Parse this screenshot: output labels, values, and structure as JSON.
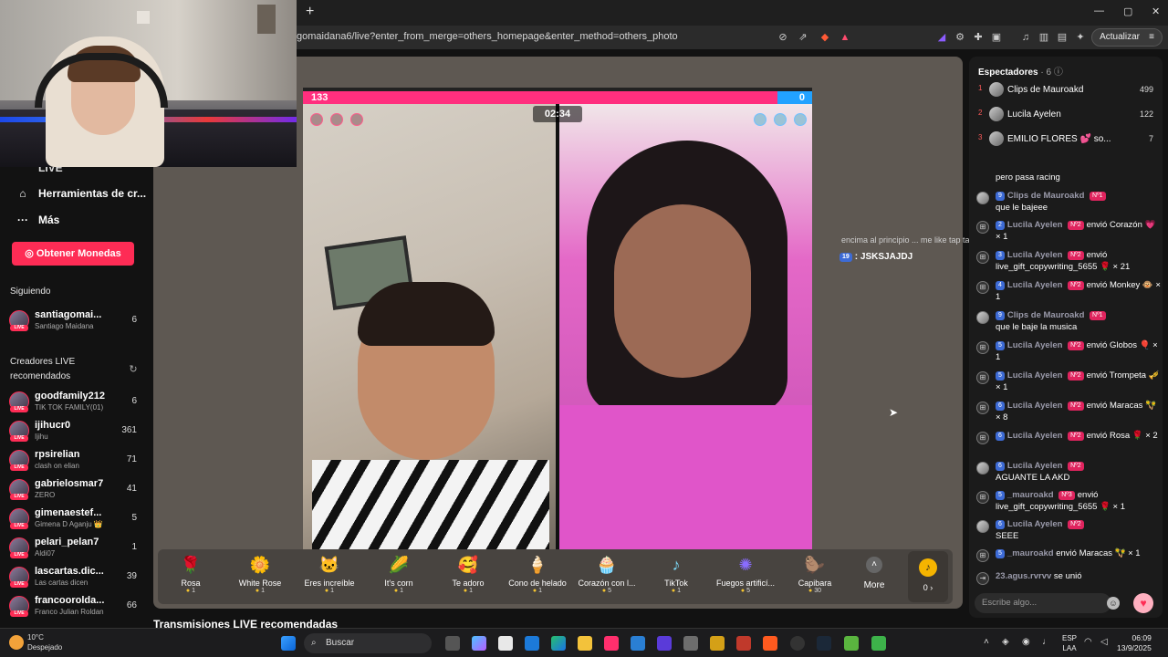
{
  "browser": {
    "new_tab": "+",
    "url": "gomaidana6/live?enter_from_merge=others_homepage&enter_method=others_photo",
    "update_button": "Actualizar",
    "window_controls": [
      "—",
      "▢",
      "✕"
    ]
  },
  "sidebar": {
    "partial_item": "LIVE",
    "nav": [
      {
        "icon": "tools-icon",
        "label": "Herramientas de cr..."
      },
      {
        "icon": "more-dots-icon",
        "label": "Más"
      }
    ],
    "coins_button": "Obtener Monedas",
    "following_title": "Siguiendo",
    "following": [
      {
        "name": "santiagomai...",
        "sub": "Santiago Maidana",
        "count": "6"
      }
    ],
    "recommended_title": "Creadores LIVE recomendados",
    "recommended": [
      {
        "name": "goodfamily212",
        "sub": "TIK TOK FAMILY(01)",
        "count": "6"
      },
      {
        "name": "ijihucr0",
        "sub": "Ijihu",
        "count": "361"
      },
      {
        "name": "rpsirelian",
        "sub": "clash on elian",
        "count": "71"
      },
      {
        "name": "gabrielosmar7",
        "sub": "ZERO",
        "count": "41"
      },
      {
        "name": "gimenaestef...",
        "sub": "Gimena D Aganju 👑",
        "count": "5"
      },
      {
        "name": "pelari_pelan7",
        "sub": "Aldi07",
        "count": "1"
      },
      {
        "name": "lascartas.dic...",
        "sub": "Las cartas dicen",
        "count": "39"
      },
      {
        "name": "francoorolda...",
        "sub": "Franco Julian Roldan",
        "count": "66"
      }
    ],
    "live_badge": "LIVE"
  },
  "battle": {
    "score_left": "133",
    "score_right": "0",
    "timer": "02:34",
    "chat_line1": "encima al principio ... me like tap tap a la panta",
    "chat_line2_level": "19",
    "chat_line2_text": ": JSKSJAJDJ"
  },
  "gifts": [
    {
      "name": "Rosa",
      "price": "1",
      "icon": "🌹",
      "color": "#c0204a"
    },
    {
      "name": "White Rose",
      "price": "1",
      "icon": "🌼",
      "color": "#e8e8d8"
    },
    {
      "name": "Eres increíble",
      "price": "1",
      "icon": "🐱",
      "color": "#d2a46a"
    },
    {
      "name": "It's corn",
      "price": "1",
      "icon": "🌽",
      "color": "#f2c230"
    },
    {
      "name": "Te adoro",
      "price": "1",
      "icon": "🥰",
      "color": "#ff5a4a"
    },
    {
      "name": "Cono de helado",
      "price": "1",
      "icon": "🍦",
      "color": "#f5b8d0"
    },
    {
      "name": "Corazón con l...",
      "price": "5",
      "icon": "🧁",
      "color": "#f6a38c"
    },
    {
      "name": "TikTok",
      "price": "1",
      "icon": "♪",
      "color": "#7ad3f0"
    },
    {
      "name": "Fuegos artificí...",
      "price": "5",
      "icon": "✺",
      "color": "#8a6cff"
    },
    {
      "name": "Capibara",
      "price": "30",
      "icon": "🦫",
      "color": "#a57a4c"
    }
  ],
  "more_label": "More",
  "coins_balance": "0 ›",
  "recommended_section": "Transmisiones LIVE recomendadas",
  "viewers": {
    "title": "Espectadores",
    "count": "· 6",
    "list": [
      {
        "rank": "1",
        "name": "Clips de Mauroakd",
        "score": "499"
      },
      {
        "rank": "2",
        "name": "Lucila Ayelen",
        "score": "122"
      },
      {
        "rank": "3",
        "name": "EMILIO FLORES 💕 so...",
        "score": "7"
      }
    ]
  },
  "chat": [
    {
      "type": "text",
      "level": "",
      "user": "",
      "rank": "",
      "text": "pero pasa racing"
    },
    {
      "type": "avatar",
      "level": "9",
      "user": "Clips de Mauroakd",
      "rank": "Nº1",
      "text": "que le bajeee"
    },
    {
      "type": "gift",
      "level": "2",
      "user": "Lucila Ayelen",
      "rank": "Nº2",
      "text": "envió Corazón 💗 × 1"
    },
    {
      "type": "gift",
      "level": "3",
      "user": "Lucila Ayelen",
      "rank": "Nº2",
      "text": "envió live_gift_copywriting_5655 🌹 × 21"
    },
    {
      "type": "gift",
      "level": "4",
      "user": "Lucila Ayelen",
      "rank": "Nº2",
      "text": "envió Monkey 🐵 × 1"
    },
    {
      "type": "avatar",
      "level": "9",
      "user": "Clips de Mauroakd",
      "rank": "Nº1",
      "text": "que le baje la musica"
    },
    {
      "type": "gift",
      "level": "5",
      "user": "Lucila Ayelen",
      "rank": "Nº2",
      "text": "envió Globos 🎈 × 1"
    },
    {
      "type": "gift",
      "level": "5",
      "user": "Lucila Ayelen",
      "rank": "Nº2",
      "text": "envió Trompeta 🎺 × 1"
    },
    {
      "type": "gift",
      "level": "6",
      "user": "Lucila Ayelen",
      "rank": "Nº2",
      "text": "envió Maracas 🪇 × 8"
    },
    {
      "type": "gift",
      "level": "6",
      "user": "Lucila Ayelen",
      "rank": "Nº2",
      "text": "envió Rosa 🌹 × 2"
    },
    {
      "type": "avatar",
      "level": "6",
      "user": "Lucila Ayelen",
      "rank": "Nº2",
      "text": "AGUANTE LA AKD"
    },
    {
      "type": "gift",
      "level": "5",
      "user": "_mauroakd",
      "rank": "Nº3",
      "text": "envió live_gift_copywriting_5655 🌹 × 1"
    },
    {
      "type": "avatar",
      "level": "6",
      "user": "Lucila Ayelen",
      "rank": "Nº2",
      "text": "SEEE"
    },
    {
      "type": "gift",
      "level": "5",
      "user": "_mauroakd",
      "rank": "",
      "text": "envió Maracas 🪇 × 1"
    },
    {
      "type": "join",
      "level": "",
      "user": "23.agus.rvrvv",
      "rank": "",
      "text": "se unió"
    }
  ],
  "comment_placeholder": "Escribe algo...",
  "taskbar": {
    "temp": "10°C",
    "weather": "Despejado",
    "search": "Buscar",
    "lang1": "ESP",
    "lang2": "LAA",
    "time": "06:09",
    "date": "13/9/2025"
  }
}
